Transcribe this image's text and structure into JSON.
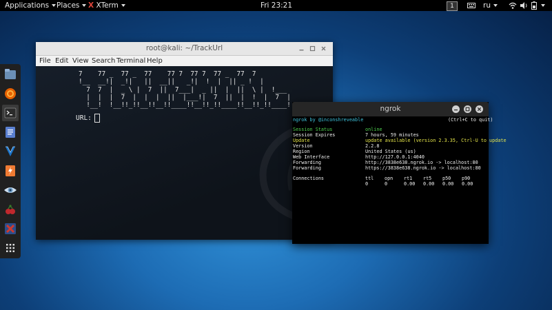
{
  "top_panel": {
    "applications": "Applications",
    "places": "Places",
    "active_app": "XTerm",
    "clock": "Fri 23:21",
    "workspace": "1",
    "language": "ru"
  },
  "dock": {
    "items": [
      {
        "name": "files-app-icon",
        "color": "#6b8fb5"
      },
      {
        "name": "firefox-icon",
        "color": "#e66000"
      },
      {
        "name": "terminal-icon",
        "color": "#2b2b2b"
      },
      {
        "name": "text-editor-icon",
        "color": "#5a7fcf"
      },
      {
        "name": "metasploit-icon",
        "color": "#1a73c7"
      },
      {
        "name": "burpsuite-icon",
        "color": "#f07b33"
      },
      {
        "name": "eye-tool-icon",
        "color": "#6a9ac4"
      },
      {
        "name": "cherrytree-icon",
        "color": "#c0282d"
      },
      {
        "name": "xterm-icon",
        "color": "#d03a2e"
      },
      {
        "name": "show-apps-icon",
        "color": "#e0e0e0"
      }
    ]
  },
  "xterm": {
    "title": "root@kali: ~/TrackUrl",
    "menu": [
      "File",
      "Edit",
      "View",
      "Search",
      "Terminal",
      "Help"
    ],
    "banner": "7    77 _  77 _  77    77 7  77 7  77 _  77  7\n!__  __!|  _!|   ||  __||   _!|  !  |  || _ !  |\n  7  7  |  _ \\ |  7  ||  7___|  _ ||  |  ||  \\ |  !___\n  |  |  |  7  |  |  |  ||  |___!|  7  ||  |  !  |  7  |\n  !__!  !__!!_!!__!!__!!____!!__!!_!!____!!__!!_!!____!",
    "url_prompt": "URL:"
  },
  "ngrok": {
    "title": "ngrok",
    "header_left": "ngrok by @inconshreveable",
    "header_right": "(Ctrl+C to quit)",
    "rows": [
      {
        "label": "Session Status",
        "value": "online"
      },
      {
        "label": "Session Expires",
        "value": "7 hours, 59 minutes"
      },
      {
        "label": "Update",
        "value": "update available (version 2.3.35, Ctrl-U to update"
      },
      {
        "label": "Version",
        "value": "2.2.8"
      },
      {
        "label": "Region",
        "value": "United States (us)"
      },
      {
        "label": "Web Interface",
        "value": "http://127.0.0.1:4040"
      },
      {
        "label": "Forwarding",
        "value": "http://3838e638.ngrok.io -> localhost:80"
      },
      {
        "label": "Forwarding",
        "value": "https://3838e638.ngrok.io -> localhost:80"
      }
    ],
    "connections": {
      "label": "Connections",
      "headers": [
        "ttl",
        "opn",
        "rt1",
        "rt5",
        "p50",
        "p90"
      ],
      "values": [
        "0",
        "0",
        "0.00",
        "0.00",
        "0.00",
        "0.00"
      ]
    },
    "colors": {
      "online": "#4fd24f",
      "update": "#e6e64a",
      "brand": "#3fc6e0"
    }
  }
}
